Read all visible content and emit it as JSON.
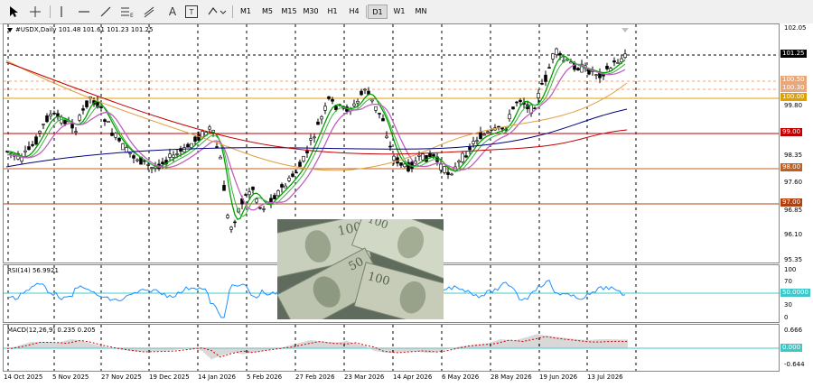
{
  "toolbar": {
    "tools": [
      {
        "name": "cursor-tool-icon"
      },
      {
        "name": "crosshair-tool-icon"
      },
      {
        "name": "vertical-line-tool-icon"
      },
      {
        "name": "horizontal-line-tool-icon"
      },
      {
        "name": "trendline-tool-icon"
      },
      {
        "name": "fibonacci-tool-icon",
        "label": "E"
      },
      {
        "name": "channel-tool-icon"
      },
      {
        "name": "text-tool-icon",
        "label": "A"
      },
      {
        "name": "label-tool-icon",
        "label": "T"
      },
      {
        "name": "shapes-tool-icon"
      }
    ],
    "timeframes": [
      "M1",
      "M5",
      "M15",
      "M30",
      "H1",
      "H4",
      "D1",
      "W1",
      "MN"
    ],
    "active_timeframe": "D1"
  },
  "main_pane": {
    "title": "#USDX,Daily  101.48 101.61 101.23 101.25",
    "price_labels": [
      "102.05",
      "101.25",
      "100.50",
      "100.30",
      "100.00",
      "99.80",
      "99.00",
      "98.35",
      "98.00",
      "97.60",
      "97.00",
      "96.85",
      "96.10",
      "95.35"
    ],
    "tags": [
      {
        "text": "101.25",
        "color": "#000000"
      },
      {
        "text": "100.50",
        "color": "#e8a87c"
      },
      {
        "text": "100.30",
        "color": "#e8a87c"
      },
      {
        "text": "100.00",
        "color": "#e0a000"
      },
      {
        "text": "99.00",
        "color": "#c00000"
      },
      {
        "text": "98.00",
        "color": "#c06020"
      },
      {
        "text": "97.00",
        "color": "#b04010"
      }
    ]
  },
  "rsi_pane": {
    "title": "RSI(14) 56.9921",
    "scale_labels": [
      "100",
      "70",
      "50.0000",
      "30",
      "0"
    ]
  },
  "macd_pane": {
    "title": "MACD(12,26,9) 0.235 0.205",
    "scale_labels": [
      "0.666",
      "0.000",
      "-0.644"
    ]
  },
  "date_labels": [
    "14 Oct 2025",
    "5 Nov 2025",
    "27 Nov 2025",
    "19 Dec 2025",
    "14 Jan 2026",
    "5 Feb 2026",
    "27 Feb 2026",
    "23 Mar 2026",
    "14 Apr 2026",
    "6 May 2026",
    "28 May 2026",
    "19 Jun 2026",
    "13 Jul 2026"
  ],
  "colors": {
    "candle": "#000000",
    "ma_fast": "#00a000",
    "ma_mid": "#c060c0",
    "ma_slow": "#e0a040",
    "ma_long_blue": "#000080",
    "ma_long_red": "#c00000",
    "rsi_line": "#1e90ff",
    "macd_signal": "#d00000"
  }
}
